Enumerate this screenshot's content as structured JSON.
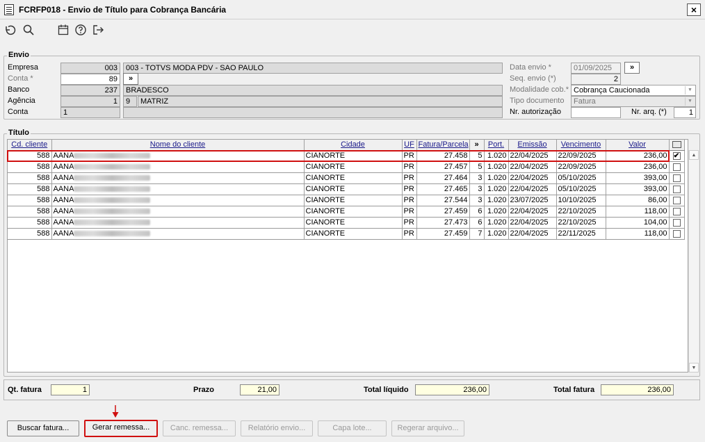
{
  "window": {
    "title": "FCRFP018 - Envio de Título para Cobrança Bancária",
    "close": "×"
  },
  "toolbar": {
    "icons": [
      "undo-icon",
      "search-icon",
      "calendar-icon",
      "help-icon",
      "exit-icon"
    ]
  },
  "envio": {
    "legend": "Envio",
    "empresa_label": "Empresa",
    "empresa_code": "003",
    "empresa_name": "003 - TOTVS MODA PDV - SAO PAULO",
    "conta_label": "Conta *",
    "conta_value": "89",
    "banco_label": "Banco",
    "banco_code": "237",
    "banco_name": "BRADESCO",
    "agencia_label": "Agência",
    "agencia_code": "1",
    "agencia_dv": "9",
    "agencia_name": "MATRIZ",
    "conta2_label": "Conta",
    "conta2_value": "1",
    "data_envio_label": "Data envio *",
    "data_envio_value": "01/09/2025",
    "seq_envio_label": "Seq. envio (*)",
    "seq_envio_value": "2",
    "modalidade_label": "Modalidade cob.*",
    "modalidade_value": "Cobrança Caucionada",
    "tipo_doc_label": "Tipo documento",
    "tipo_doc_value": "Fatura",
    "nr_aut_label": "Nr. autorização",
    "nr_aut_value": "",
    "nr_arq_label": "Nr. arq. (*)",
    "nr_arq_value": "1",
    "expand_btn": "»"
  },
  "titulo": {
    "legend": "Título",
    "columns": [
      "Cd. cliente",
      "Nome do cliente",
      "Cidade",
      "UF",
      "Fatura/Parcela",
      "»",
      "Port.",
      "Emissão",
      "Vencimento",
      "Valor"
    ],
    "rows": [
      {
        "cd": "588",
        "nome": "AANA",
        "cidade": "CIANORTE",
        "uf": "PR",
        "fatura": "27.458",
        "parcela": "5",
        "port": "1.020",
        "emissao": "22/04/2025",
        "venc": "22/09/2025",
        "valor": "236,00",
        "checked": "✔"
      },
      {
        "cd": "588",
        "nome": "AANA",
        "cidade": "CIANORTE",
        "uf": "PR",
        "fatura": "27.457",
        "parcela": "5",
        "port": "1.020",
        "emissao": "22/04/2025",
        "venc": "22/09/2025",
        "valor": "236,00",
        "checked": ""
      },
      {
        "cd": "588",
        "nome": "AANA",
        "cidade": "CIANORTE",
        "uf": "PR",
        "fatura": "27.464",
        "parcela": "3",
        "port": "1.020",
        "emissao": "22/04/2025",
        "venc": "05/10/2025",
        "valor": "393,00",
        "checked": ""
      },
      {
        "cd": "588",
        "nome": "AANA",
        "cidade": "CIANORTE",
        "uf": "PR",
        "fatura": "27.465",
        "parcela": "3",
        "port": "1.020",
        "emissao": "22/04/2025",
        "venc": "05/10/2025",
        "valor": "393,00",
        "checked": ""
      },
      {
        "cd": "588",
        "nome": "AANA",
        "cidade": "CIANORTE",
        "uf": "PR",
        "fatura": "27.544",
        "parcela": "3",
        "port": "1.020",
        "emissao": "23/07/2025",
        "venc": "10/10/2025",
        "valor": "86,00",
        "checked": ""
      },
      {
        "cd": "588",
        "nome": "AANA",
        "cidade": "CIANORTE",
        "uf": "PR",
        "fatura": "27.459",
        "parcela": "6",
        "port": "1.020",
        "emissao": "22/04/2025",
        "venc": "22/10/2025",
        "valor": "118,00",
        "checked": ""
      },
      {
        "cd": "588",
        "nome": "AANA",
        "cidade": "CIANORTE",
        "uf": "PR",
        "fatura": "27.473",
        "parcela": "6",
        "port": "1.020",
        "emissao": "22/04/2025",
        "venc": "22/10/2025",
        "valor": "104,00",
        "checked": ""
      },
      {
        "cd": "588",
        "nome": "AANA",
        "cidade": "CIANORTE",
        "uf": "PR",
        "fatura": "27.459",
        "parcela": "7",
        "port": "1.020",
        "emissao": "22/04/2025",
        "venc": "22/11/2025",
        "valor": "118,00",
        "checked": ""
      }
    ]
  },
  "totals": {
    "qt_fatura_label": "Qt. fatura",
    "qt_fatura_value": "1",
    "prazo_label": "Prazo",
    "prazo_value": "21,00",
    "total_liquido_label": "Total líquido",
    "total_liquido_value": "236,00",
    "total_fatura_label": "Total fatura",
    "total_fatura_value": "236,00"
  },
  "buttons": {
    "buscar": "Buscar fatura...",
    "gerar": "Gerar remessa...",
    "canc": "Canc. remessa...",
    "relatorio": "Relatório envio...",
    "capa": "Capa lote...",
    "regerar": "Regerar arquivo..."
  },
  "colors": {
    "highlight": "#d01010",
    "header_text": "#1a1a8a",
    "total_field": "#ffffe1"
  }
}
